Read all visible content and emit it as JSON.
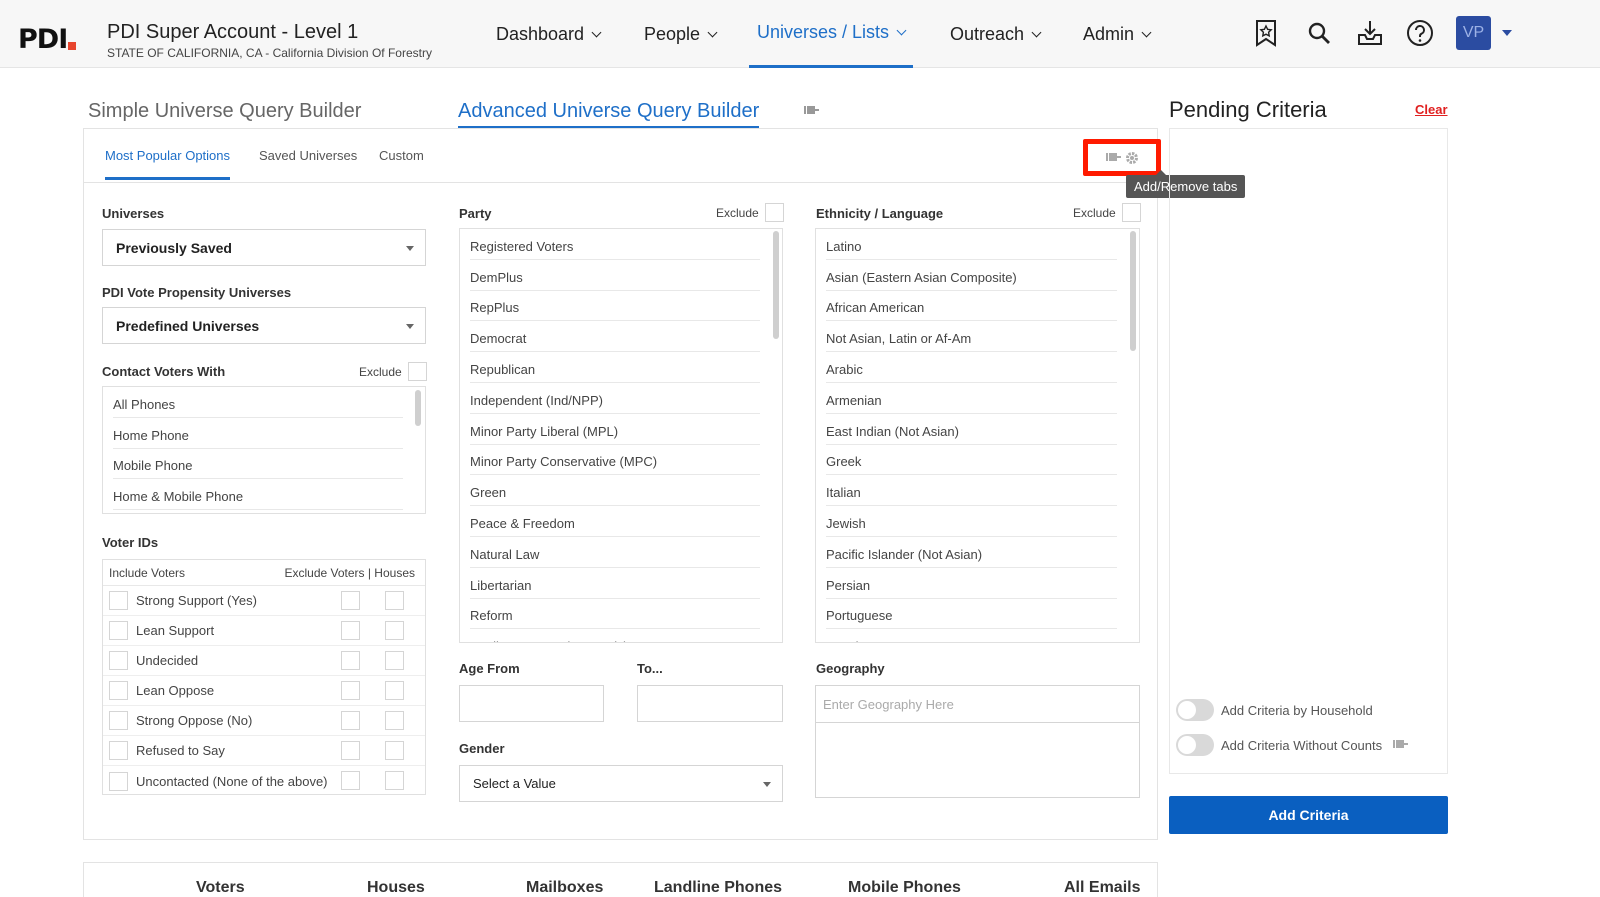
{
  "account": {
    "logo_text": "PDI",
    "title": "PDI Super Account - Level 1",
    "subtitle": "STATE OF CALIFORNIA, CA - California Division Of Forestry"
  },
  "nav": {
    "items": [
      {
        "label": "Dashboard",
        "active": false
      },
      {
        "label": "People",
        "active": false
      },
      {
        "label": "Universes / Lists",
        "active": true
      },
      {
        "label": "Outreach",
        "active": false
      },
      {
        "label": "Admin",
        "active": false
      }
    ],
    "icons": [
      "bookmark-star-icon",
      "search-icon",
      "download-tray-icon",
      "help-icon"
    ],
    "avatar_initials": "VP",
    "accent": "#1e6fc8"
  },
  "builder": {
    "simple_tab": "Simple Universe Query Builder",
    "advanced_tab": "Advanced Universe Query Builder",
    "subtabs": [
      "Most Popular Options",
      "Saved Universes",
      "Custom"
    ],
    "tooltip": "Add/Remove tabs"
  },
  "universes": {
    "label": "Universes",
    "value": "Previously Saved"
  },
  "propensity": {
    "label": "PDI Vote Propensity Universes",
    "value": "Predefined Universes"
  },
  "contact": {
    "label": "Contact Voters With",
    "exclude": "Exclude",
    "items": [
      "All Phones",
      "Home Phone",
      "Mobile Phone",
      "Home & Mobile Phone"
    ]
  },
  "voter_ids": {
    "label": "Voter IDs",
    "include_header": "Include Voters",
    "exclude_header": "Exclude Voters | Houses",
    "rows": [
      "Strong Support (Yes)",
      "Lean Support",
      "Undecided",
      "Lean Oppose",
      "Strong Oppose (No)",
      "Refused to Say",
      "Uncontacted (None of the above)"
    ]
  },
  "party": {
    "label": "Party",
    "exclude": "Exclude",
    "items": [
      "Registered Voters",
      "DemPlus",
      "RepPlus",
      "Democrat",
      "Republican",
      "Independent (Ind/NPP)",
      "Minor Party Liberal (MPL)",
      "Minor Party Conservative (MPC)",
      "Green",
      "Peace & Freedom",
      "Natural Law",
      "Libertarian",
      "Reform",
      "Decline to State (NPP only)"
    ]
  },
  "ethnicity": {
    "label": "Ethnicity / Language",
    "exclude": "Exclude",
    "items": [
      "Latino",
      "Asian (Eastern Asian Composite)",
      "African American",
      "Not Asian, Latin or Af-Am",
      "Arabic",
      "Armenian",
      "East Indian (Not Asian)",
      "Greek",
      "Italian",
      "Jewish",
      "Pacific Islander (Not Asian)",
      "Persian",
      "Portuguese",
      "Russian"
    ]
  },
  "age": {
    "from_label": "Age From",
    "to_label": "To..."
  },
  "gender": {
    "label": "Gender",
    "value": "Select a Value"
  },
  "geography": {
    "label": "Geography",
    "placeholder": "Enter Geography Here"
  },
  "pending": {
    "title": "Pending Criteria",
    "clear": "Clear",
    "toggle_household": "Add Criteria by Household",
    "toggle_without_counts": "Add Criteria Without Counts",
    "add_button": "Add Criteria",
    "button_color": "#0a5fc0"
  },
  "counts": {
    "headers": [
      "Voters",
      "Houses",
      "Mailboxes",
      "Landline Phones",
      "Mobile Phones",
      "All Emails"
    ]
  }
}
